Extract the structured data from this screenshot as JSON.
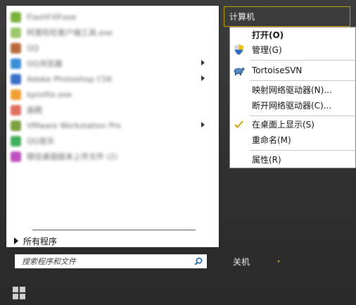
{
  "programs": [
    {
      "label": "FlashFXP.exe",
      "color": "#7cb33a",
      "submenu": false
    },
    {
      "label": "阿里旺旺客户端工具.exe",
      "color": "#9bc86a",
      "submenu": false
    },
    {
      "label": "QQ",
      "color": "#b86a3a",
      "submenu": false
    },
    {
      "label": "QQ浏览器",
      "color": "#3a8fd6",
      "submenu": true
    },
    {
      "label": "Adobe Photoshop CS6",
      "color": "#3a6fc6",
      "submenu": true
    },
    {
      "label": "kprofile.exe",
      "color": "#f0a030",
      "submenu": false
    },
    {
      "label": "画图",
      "color": "#e07060",
      "submenu": false
    },
    {
      "label": "VMware Workstation Pro",
      "color": "#7aa040",
      "submenu": true
    },
    {
      "label": "QQ音乐",
      "color": "#3fae5a",
      "submenu": false
    },
    {
      "label": "微信桌面版本上传文件 (2)",
      "color": "#c050c0",
      "submenu": false
    }
  ],
  "all_programs_label": "所有程序",
  "search": {
    "placeholder": "搜索程序和文件"
  },
  "shutdown_label": "关机",
  "computer_label": "计算机",
  "context_menu": {
    "open": "打开(O)",
    "manage": "管理(G)",
    "tortoise": "TortoiseSVN",
    "map_drive": "映射网络驱动器(N)...",
    "disconnect_drive": "断开网络驱动器(C)...",
    "show_desktop": "在桌面上显示(S)",
    "rename": "重命名(M)",
    "properties": "属性(R)"
  },
  "colors": {
    "tile_border": "#c0a000",
    "check": "#c9a400"
  }
}
